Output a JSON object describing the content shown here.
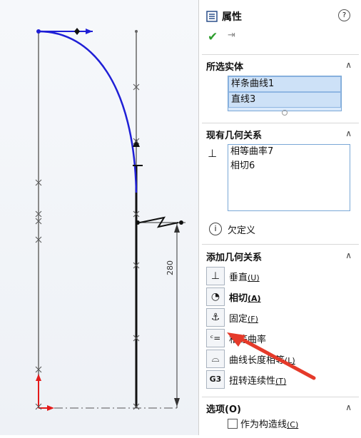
{
  "panel": {
    "title": "属性",
    "help_glyph": "?",
    "ok_glyph": "✔",
    "pin_glyph": "⇥"
  },
  "selected_entities": {
    "title": "所选实体",
    "items": [
      "样条曲线1",
      "直线3"
    ]
  },
  "existing_relations": {
    "title": "现有几何关系",
    "items": [
      "相等曲率7",
      "相切6"
    ],
    "status": "欠定义"
  },
  "add_relations": {
    "title": "添加几何关系",
    "items": [
      {
        "label": "垂直",
        "key": "(U)",
        "icon": "perpendicular-icon"
      },
      {
        "label": "相切",
        "key": "(A)",
        "icon": "tangent-icon"
      },
      {
        "label": "固定",
        "key": "(F)",
        "icon": "fix-icon"
      },
      {
        "label": "相等曲率",
        "key": "",
        "icon": "equal-curvature-icon"
      },
      {
        "label": "曲线长度相等",
        "key": "(L)",
        "icon": "equal-length-icon"
      },
      {
        "label": "扭转连续性",
        "key": "(T)",
        "icon": "torsion-continuity-icon"
      }
    ]
  },
  "options": {
    "title": "选项(O)",
    "construction_label": "作为构造线",
    "construction_key": "(C)"
  },
  "sketch": {
    "dimension": "280"
  },
  "colors": {
    "spline": "#1f1fd6",
    "arrow": "#e53a2a",
    "axis_red": "#e31b1b"
  }
}
